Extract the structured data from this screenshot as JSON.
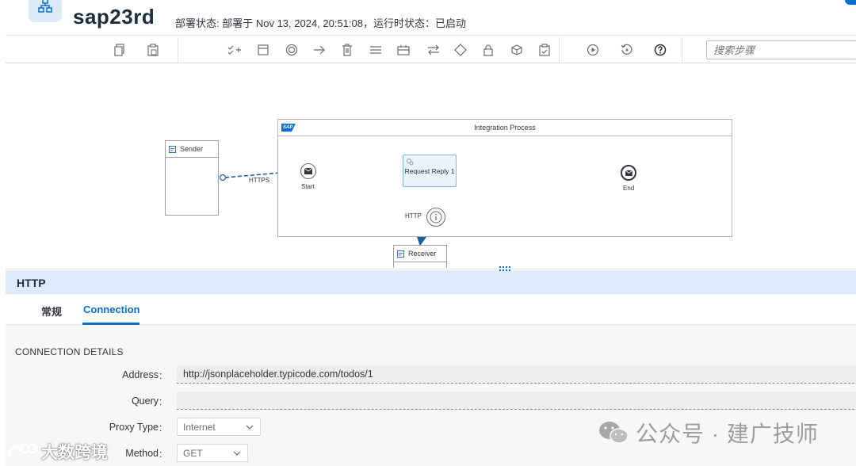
{
  "header": {
    "title": "sap23rd",
    "status": "部署状态: 部署于 Nov 13, 2024, 20:51:08，运行时状态：已启动"
  },
  "toolbar": {
    "groups": [
      [
        "copy-icon",
        "paste-icon"
      ],
      [
        "add-steps-icon",
        "participant-icon",
        "event-icon",
        "arrow-icon",
        "delete-icon",
        "list-icon",
        "call-icon",
        "swap-icon",
        "gateway-icon",
        "lock-icon",
        "module-icon",
        "clipboard-check-icon"
      ],
      [
        "play-icon",
        "reset-icon",
        "help-icon"
      ]
    ],
    "search_placeholder": "搜索步骤"
  },
  "diagram": {
    "pool_title": "Integration Process",
    "sap_logo": "SAP",
    "sender": "Sender",
    "receiver": "Receiver",
    "start_label": "Start",
    "end_label": "End",
    "task_label": "Request Reply 1",
    "sender_flow_label": "HTTPS",
    "receiver_flow_label": "HTTP"
  },
  "panel": {
    "title": "HTTP",
    "tabs": [
      {
        "label": "常规",
        "active": false
      },
      {
        "label": "Connection",
        "active": true
      }
    ],
    "section_title": "CONNECTION DETAILS",
    "fields": {
      "address": {
        "label": "Address",
        "value": "http://jsonplaceholder.typicode.com/todos/1"
      },
      "query": {
        "label": "Query",
        "value": ""
      },
      "proxy_type": {
        "label": "Proxy Type",
        "value": "Internet"
      },
      "method": {
        "label": "Method",
        "value": "GET"
      }
    },
    "colon": ":"
  },
  "watermarks": {
    "right": "公众号 · 建广技师",
    "left": "大数跨境"
  },
  "colors": {
    "accent": "#0a6ed1",
    "panel_header": "#dceafa",
    "task_fill": "#eaf3fb"
  }
}
